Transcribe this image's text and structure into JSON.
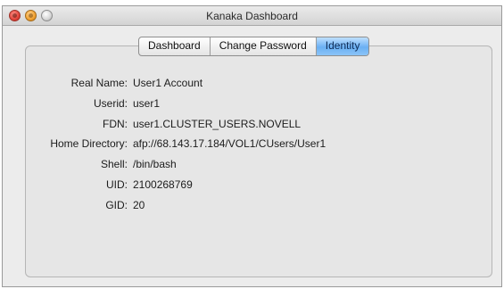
{
  "window": {
    "title": "Kanaka Dashboard"
  },
  "tabs": [
    {
      "label": "Dashboard",
      "active": false
    },
    {
      "label": "Change Password",
      "active": false
    },
    {
      "label": "Identity",
      "active": true
    }
  ],
  "identity": {
    "fields": [
      {
        "label": "Real Name:",
        "value": "User1 Account"
      },
      {
        "label": "Userid:",
        "value": "user1"
      },
      {
        "label": "FDN:",
        "value": "user1.CLUSTER_USERS.NOVELL"
      },
      {
        "label": "Home Directory:",
        "value": "afp://68.143.17.184/VOL1/CUsers/User1"
      },
      {
        "label": "Shell:",
        "value": "/bin/bash"
      },
      {
        "label": "UID:",
        "value": "2100268769"
      },
      {
        "label": "GID:",
        "value": "20"
      }
    ]
  },
  "colors": {
    "active_tab": "#6ab0f3",
    "window_bg": "#ececec"
  }
}
